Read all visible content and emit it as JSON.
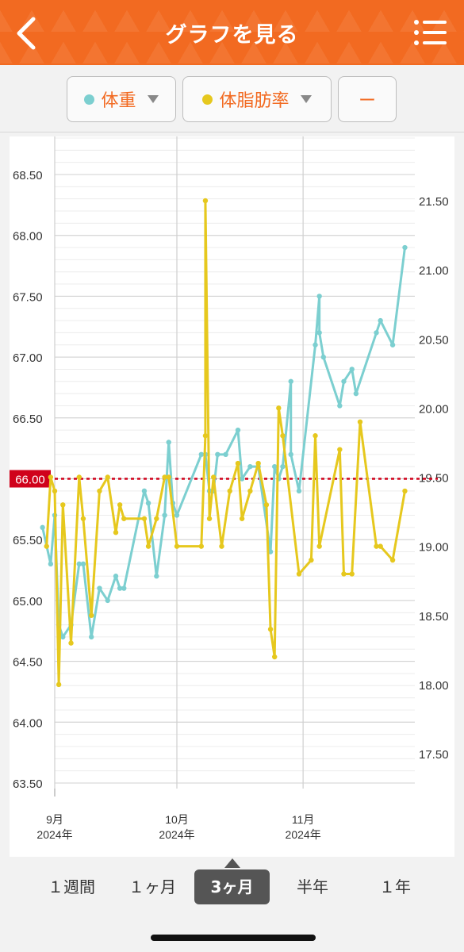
{
  "header": {
    "title": "グラフを見る",
    "back_icon": "chevron-left-icon",
    "menu_icon": "list-menu-icon"
  },
  "selectors": [
    {
      "label": "体重",
      "dot_color": "#7ccfd0"
    },
    {
      "label": "体脂肪率",
      "dot_color": "#e6c81e"
    },
    {
      "label": "ー"
    }
  ],
  "tabs": [
    {
      "label": "１週間"
    },
    {
      "label": "１ヶ月"
    },
    {
      "label": "3ヶ月",
      "active": true
    },
    {
      "label": "半年"
    },
    {
      "label": "１年"
    }
  ],
  "chart_data": {
    "type": "line",
    "y_left": {
      "min": 63.3,
      "max": 68.8,
      "ticks": [
        "63.50",
        "64.00",
        "64.50",
        "65.00",
        "65.50",
        "66.00",
        "66.50",
        "67.00",
        "67.50",
        "68.00",
        "68.50"
      ]
    },
    "y_right": {
      "min": 17.2,
      "max": 21.78,
      "ticks": [
        "17.50",
        "18.00",
        "18.50",
        "19.00",
        "19.50",
        "20.00",
        "20.50",
        "21.00",
        "21.50"
      ]
    },
    "x_ticks": [
      {
        "month": "9月",
        "year": "2024年",
        "date": "2024-09-01"
      },
      {
        "month": "10月",
        "year": "2024年",
        "date": "2024-10-01"
      },
      {
        "month": "11月",
        "year": "2024年",
        "date": "2024-11-01"
      }
    ],
    "target": {
      "value": 66.0,
      "label": "66.00",
      "color": "#d0021b"
    },
    "series": [
      {
        "name": "体重",
        "axis": "left",
        "color": "#7ccfd0",
        "points": [
          [
            "2024-08-29",
            65.6
          ],
          [
            "2024-08-31",
            65.3
          ],
          [
            "2024-09-01",
            65.7
          ],
          [
            "2024-09-02",
            64.8
          ],
          [
            "2024-09-03",
            64.7
          ],
          [
            "2024-09-05",
            64.8
          ],
          [
            "2024-09-07",
            65.3
          ],
          [
            "2024-09-08",
            65.3
          ],
          [
            "2024-09-10",
            64.7
          ],
          [
            "2024-09-12",
            65.1
          ],
          [
            "2024-09-14",
            65.0
          ],
          [
            "2024-09-16",
            65.2
          ],
          [
            "2024-09-17",
            65.1
          ],
          [
            "2024-09-18",
            65.1
          ],
          [
            "2024-09-23",
            65.9
          ],
          [
            "2024-09-24",
            65.8
          ],
          [
            "2024-09-26",
            65.2
          ],
          [
            "2024-09-28",
            65.7
          ],
          [
            "2024-09-29",
            66.3
          ],
          [
            "2024-09-30",
            65.8
          ],
          [
            "2024-10-01",
            65.7
          ],
          [
            "2024-10-07",
            66.2
          ],
          [
            "2024-10-08",
            66.2
          ],
          [
            "2024-10-09",
            65.9
          ],
          [
            "2024-10-10",
            65.9
          ],
          [
            "2024-10-11",
            66.2
          ],
          [
            "2024-10-13",
            66.2
          ],
          [
            "2024-10-16",
            66.4
          ],
          [
            "2024-10-17",
            66.0
          ],
          [
            "2024-10-19",
            66.1
          ],
          [
            "2024-10-21",
            66.1
          ],
          [
            "2024-10-24",
            65.4
          ],
          [
            "2024-10-25",
            66.1
          ],
          [
            "2024-10-26",
            66.0
          ],
          [
            "2024-10-27",
            66.1
          ],
          [
            "2024-10-29",
            66.8
          ],
          [
            "2024-10-29",
            66.2
          ],
          [
            "2024-10-31",
            65.9
          ],
          [
            "2024-11-04",
            67.1
          ],
          [
            "2024-11-05",
            67.5
          ],
          [
            "2024-11-05",
            67.2
          ],
          [
            "2024-11-06",
            67.0
          ],
          [
            "2024-11-10",
            66.6
          ],
          [
            "2024-11-11",
            66.8
          ],
          [
            "2024-11-13",
            66.9
          ],
          [
            "2024-11-14",
            66.7
          ],
          [
            "2024-11-19",
            67.2
          ],
          [
            "2024-11-20",
            67.3
          ],
          [
            "2024-11-23",
            67.1
          ],
          [
            "2024-11-26",
            67.9
          ]
        ]
      },
      {
        "name": "体脂肪率",
        "axis": "right",
        "color": "#e6c81e",
        "points": [
          [
            "2024-08-30",
            19.0
          ],
          [
            "2024-08-31",
            19.5
          ],
          [
            "2024-09-01",
            19.4
          ],
          [
            "2024-09-02",
            18.0
          ],
          [
            "2024-09-03",
            19.3
          ],
          [
            "2024-09-05",
            18.3
          ],
          [
            "2024-09-07",
            19.5
          ],
          [
            "2024-09-08",
            19.2
          ],
          [
            "2024-09-10",
            18.5
          ],
          [
            "2024-09-12",
            19.4
          ],
          [
            "2024-09-14",
            19.5
          ],
          [
            "2024-09-16",
            19.1
          ],
          [
            "2024-09-17",
            19.3
          ],
          [
            "2024-09-18",
            19.2
          ],
          [
            "2024-09-23",
            19.2
          ],
          [
            "2024-09-24",
            19.0
          ],
          [
            "2024-09-26",
            19.2
          ],
          [
            "2024-09-28",
            19.5
          ],
          [
            "2024-09-29",
            19.5
          ],
          [
            "2024-10-01",
            19.0
          ],
          [
            "2024-10-07",
            19.0
          ],
          [
            "2024-10-08",
            19.8
          ],
          [
            "2024-10-08",
            21.5
          ],
          [
            "2024-10-09",
            19.2
          ],
          [
            "2024-10-10",
            19.5
          ],
          [
            "2024-10-12",
            19.0
          ],
          [
            "2024-10-14",
            19.4
          ],
          [
            "2024-10-16",
            19.6
          ],
          [
            "2024-10-17",
            19.2
          ],
          [
            "2024-10-19",
            19.4
          ],
          [
            "2024-10-21",
            19.6
          ],
          [
            "2024-10-23",
            19.3
          ],
          [
            "2024-10-24",
            18.4
          ],
          [
            "2024-10-25",
            18.2
          ],
          [
            "2024-10-26",
            20.0
          ],
          [
            "2024-10-27",
            19.8
          ],
          [
            "2024-10-31",
            18.8
          ],
          [
            "2024-11-03",
            18.9
          ],
          [
            "2024-11-04",
            19.8
          ],
          [
            "2024-11-05",
            19.0
          ],
          [
            "2024-11-10",
            19.7
          ],
          [
            "2024-11-11",
            18.8
          ],
          [
            "2024-11-13",
            18.8
          ],
          [
            "2024-11-15",
            19.9
          ],
          [
            "2024-11-19",
            19.0
          ],
          [
            "2024-11-20",
            19.0
          ],
          [
            "2024-11-23",
            18.9
          ],
          [
            "2024-11-26",
            19.4
          ]
        ]
      }
    ],
    "xlabel": "",
    "ylabel": "",
    "grid": true
  }
}
